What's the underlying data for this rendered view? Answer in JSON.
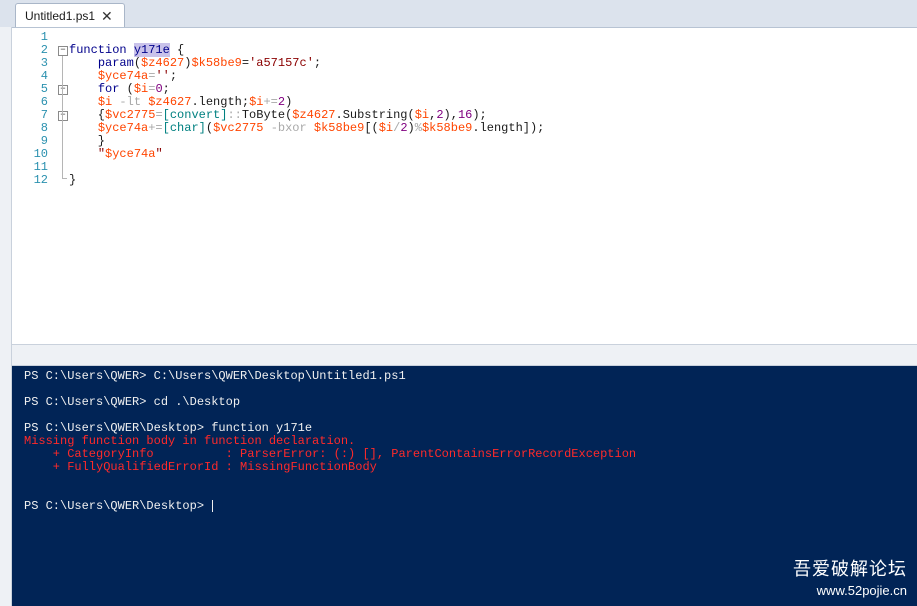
{
  "tab": {
    "title": "Untitled1.ps1",
    "close_glyph": "✕"
  },
  "editor": {
    "line_numbers": [
      "1",
      "2",
      "3",
      "4",
      "5",
      "6",
      "7",
      "8",
      "9",
      "10",
      "11",
      "12"
    ],
    "fold_glyph": "−"
  },
  "console": {
    "lines": [
      "PS C:\\Users\\QWER> C:\\Users\\QWER\\Desktop\\Untitled1.ps1",
      "PS C:\\Users\\QWER> cd .\\Desktop",
      "PS C:\\Users\\QWER\\Desktop> function y171e",
      "Missing function body in function declaration.",
      "    + CategoryInfo          : ParserError: (:) [], ParentContainsErrorRecordException",
      "    + FullyQualifiedErrorId : MissingFunctionBody",
      "PS C:\\Users\\QWER\\Desktop> "
    ]
  },
  "watermark": {
    "title": "吾爱破解论坛",
    "url": "www.52pojie.cn"
  },
  "colors": {
    "console_bg": "#012456",
    "error": "#ff2a2a",
    "keyword": "#00008b",
    "variable": "#ff4500",
    "line_number": "#2b91af"
  }
}
